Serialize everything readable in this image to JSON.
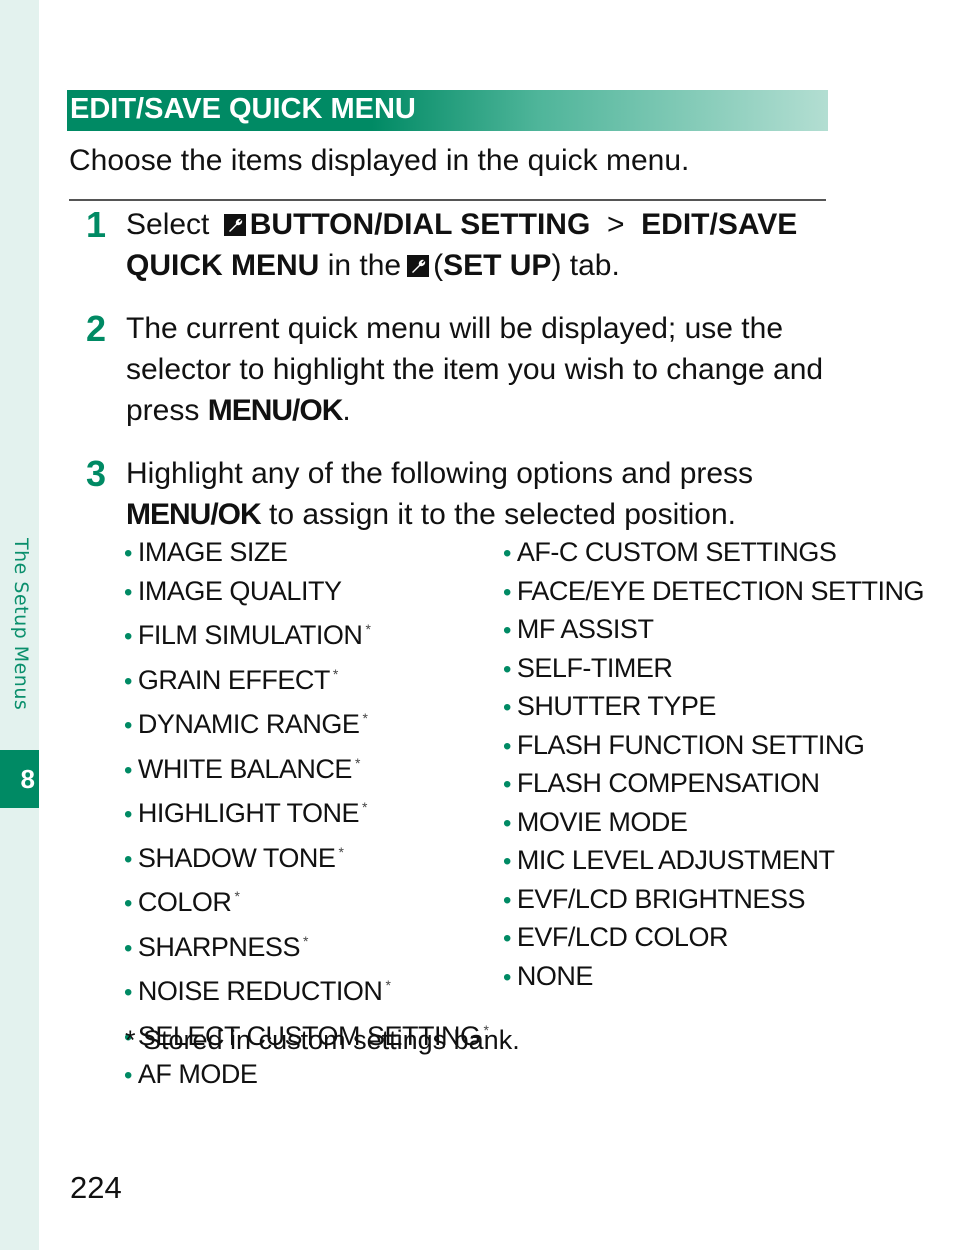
{
  "sidebar": {
    "section_label": "The Setup Menus",
    "chapter_number": "8"
  },
  "section": {
    "title": "EDIT/SAVE QUICK MENU",
    "intro": "Choose the items displayed in the quick menu."
  },
  "steps": [
    {
      "number": "1",
      "parts": {
        "select": "Select",
        "menu_path_1": "BUTTON/DIAL SETTING",
        "separator": ">",
        "menu_path_2": "EDIT/SAVE QUICK MENU",
        "in_the": "in the",
        "tab_open": "(",
        "tab_name": "SET UP",
        "tab_close": ") tab.",
        "icon": "wrench-icon"
      }
    },
    {
      "number": "2",
      "text_before": "The current quick menu will be displayed; use the selector to highlight the item you wish to change and press",
      "button": "MENU/OK",
      "text_after": "."
    },
    {
      "number": "3",
      "text_before": "Highlight any of the following options and press",
      "button": "MENU/OK",
      "text_after": "to assign it to the selected position."
    }
  ],
  "options_left": [
    {
      "label": "IMAGE SIZE",
      "stored": false
    },
    {
      "label": "IMAGE QUALITY",
      "stored": false
    },
    {
      "label": "FILM SIMULATION",
      "stored": true
    },
    {
      "label": "GRAIN EFFECT",
      "stored": true
    },
    {
      "label": "DYNAMIC RANGE",
      "stored": true
    },
    {
      "label": "WHITE BALANCE",
      "stored": true
    },
    {
      "label": "HIGHLIGHT TONE",
      "stored": true
    },
    {
      "label": "SHADOW TONE",
      "stored": true
    },
    {
      "label": "COLOR",
      "stored": true
    },
    {
      "label": "SHARPNESS",
      "stored": true
    },
    {
      "label": "NOISE REDUCTION",
      "stored": true
    },
    {
      "label": "SELECT CUSTOM SETTING",
      "stored": true
    },
    {
      "label": "AF MODE",
      "stored": false
    }
  ],
  "options_right": [
    {
      "label": "AF-C CUSTOM SETTINGS",
      "stored": false
    },
    {
      "label": "FACE/EYE DETECTION SETTING",
      "stored": false
    },
    {
      "label": "MF ASSIST",
      "stored": false
    },
    {
      "label": "SELF-TIMER",
      "stored": false
    },
    {
      "label": "SHUTTER TYPE",
      "stored": false
    },
    {
      "label": "FLASH FUNCTION SETTING",
      "stored": false
    },
    {
      "label": "FLASH COMPENSATION",
      "stored": false
    },
    {
      "label": "MOVIE MODE",
      "stored": false
    },
    {
      "label": "MIC LEVEL ADJUSTMENT",
      "stored": false
    },
    {
      "label": "EVF/LCD BRIGHTNESS",
      "stored": false
    },
    {
      "label": "EVF/LCD COLOR",
      "stored": false
    },
    {
      "label": "NONE",
      "stored": false
    }
  ],
  "bullet_char": "•",
  "star_char": "*",
  "footnote": "* Stored in custom settings bank.",
  "page_number": "224",
  "colors": {
    "accent_green": "#008a64",
    "sidebar_bg": "#e3f2ee"
  }
}
